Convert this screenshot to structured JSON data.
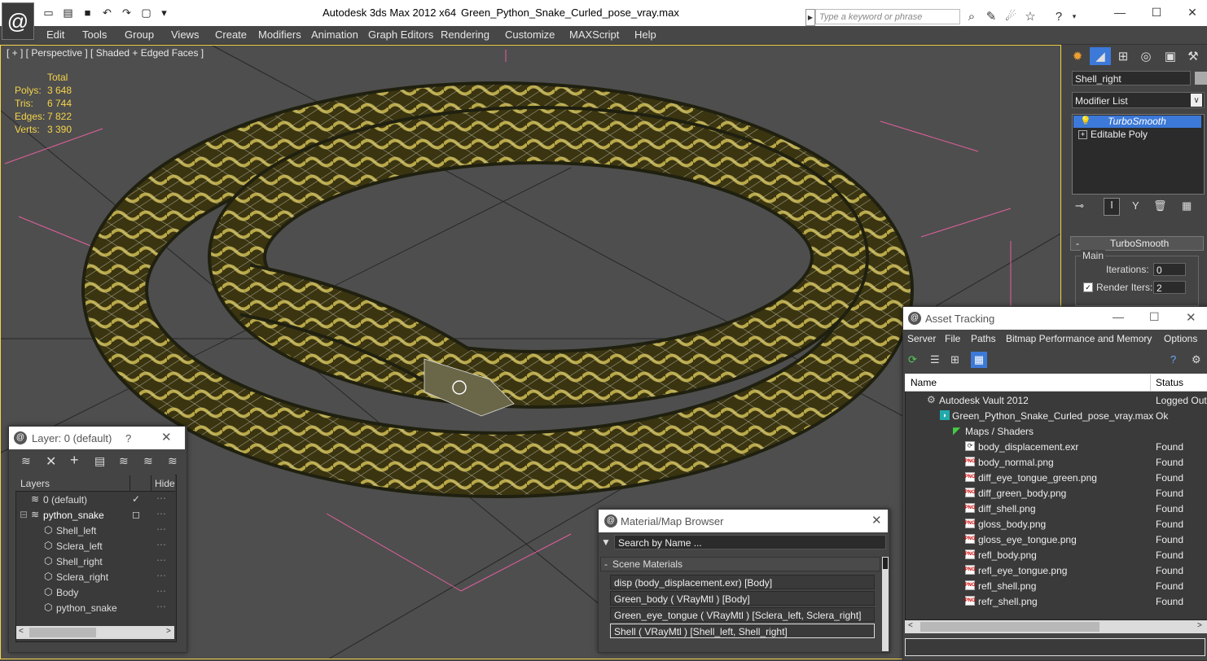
{
  "titlebar": {
    "app": "Autodesk 3ds Max  2012 x64",
    "file": "Green_Python_Snake_Curled_pose_vray.max",
    "search_placeholder": "Type a keyword or phrase"
  },
  "menu": [
    "Edit",
    "Tools",
    "Group",
    "Views",
    "Create",
    "Modifiers",
    "Animation",
    "Graph Editors",
    "Rendering",
    "Customize",
    "MAXScript",
    "Help"
  ],
  "viewport": {
    "label": "[ + ] [ Perspective ] [ Shaded + Edged Faces ]",
    "stats": {
      "header": "Total",
      "rows": [
        {
          "label": "Polys:",
          "value": "3 648"
        },
        {
          "label": "Tris:",
          "value": "6 744"
        },
        {
          "label": "Edges:",
          "value": "7 822"
        },
        {
          "label": "Verts:",
          "value": "3 390"
        }
      ]
    }
  },
  "command_panel": {
    "object_name": "Shell_right",
    "modifier_list": "Modifier List",
    "stack": [
      "TurboSmooth",
      "Editable Poly"
    ],
    "rollout_title": "TurboSmooth",
    "group_main": "Main",
    "iterations_label": "Iterations:",
    "iterations_value": "0",
    "render_iters_label": "Render Iters:",
    "render_iters_value": "2"
  },
  "layer_panel": {
    "title": "Layer: 0 (default)",
    "help": "?",
    "col_layers": "Layers",
    "col_hide": "Hide",
    "rows": [
      {
        "name": "0 (default)",
        "indent": 0
      },
      {
        "name": "python_snake",
        "indent": 0
      },
      {
        "name": "Shell_left",
        "indent": 1
      },
      {
        "name": "Sclera_left",
        "indent": 1
      },
      {
        "name": "Shell_right",
        "indent": 1
      },
      {
        "name": "Sclera_right",
        "indent": 1
      },
      {
        "name": "Body",
        "indent": 1
      },
      {
        "name": "python_snake",
        "indent": 1
      }
    ]
  },
  "material_browser": {
    "title": "Material/Map Browser",
    "search_placeholder": "Search by Name ...",
    "group": "Scene Materials",
    "items": [
      "disp (body_displacement.exr) [Body]",
      "Green_body  ( VRayMtl )  [Body]",
      "Green_eye_tongue  ( VRayMtl )  [Sclera_left, Sclera_right]",
      "Shell  ( VRayMtl )  [Shell_left, Shell_right]"
    ]
  },
  "asset_tracking": {
    "title": "Asset Tracking",
    "menu": [
      "Server",
      "File",
      "Paths",
      "Bitmap Performance and Memory",
      "Options"
    ],
    "col_name": "Name",
    "col_status": "Status",
    "rows": [
      {
        "name": "Autodesk Vault 2012",
        "status": "Logged Out",
        "level": 0,
        "icon": "vault"
      },
      {
        "name": "Green_Python_Snake_Curled_pose_vray.max",
        "status": "Ok",
        "level": 1,
        "icon": "max"
      },
      {
        "name": "Maps / Shaders",
        "status": "",
        "level": 2,
        "icon": "maps"
      },
      {
        "name": "body_displacement.exr",
        "status": "Found",
        "level": 3,
        "icon": "exr"
      },
      {
        "name": "body_normal.png",
        "status": "Found",
        "level": 3,
        "icon": "png"
      },
      {
        "name": "diff_eye_tongue_green.png",
        "status": "Found",
        "level": 3,
        "icon": "png"
      },
      {
        "name": "diff_green_body.png",
        "status": "Found",
        "level": 3,
        "icon": "png"
      },
      {
        "name": "diff_shell.png",
        "status": "Found",
        "level": 3,
        "icon": "png"
      },
      {
        "name": "gloss_body.png",
        "status": "Found",
        "level": 3,
        "icon": "png"
      },
      {
        "name": "gloss_eye_tongue.png",
        "status": "Found",
        "level": 3,
        "icon": "png"
      },
      {
        "name": "refl_body.png",
        "status": "Found",
        "level": 3,
        "icon": "png"
      },
      {
        "name": "refl_eye_tongue.png",
        "status": "Found",
        "level": 3,
        "icon": "png"
      },
      {
        "name": "refl_shell.png",
        "status": "Found",
        "level": 3,
        "icon": "png"
      },
      {
        "name": "refr_shell.png",
        "status": "Found",
        "level": 3,
        "icon": "png"
      }
    ]
  },
  "colors": {
    "accent_yellow": "#f5d44a",
    "selection_blue": "#3c79d8",
    "panel_bg": "#444444"
  }
}
